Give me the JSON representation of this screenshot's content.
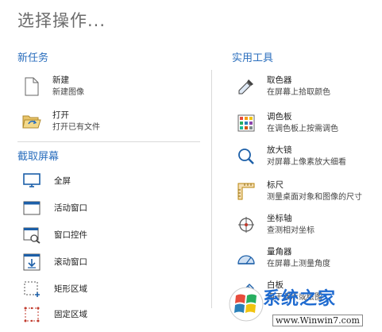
{
  "title": "选择操作...",
  "new_task": {
    "heading": "新任务",
    "items": [
      {
        "name": "新建",
        "desc": "新建图像",
        "icon": "new-document-icon"
      },
      {
        "name": "打开",
        "desc": "打开已有文件",
        "icon": "open-folder-icon"
      }
    ]
  },
  "capture": {
    "heading": "截取屏幕",
    "items": [
      {
        "name": "全屏",
        "icon": "monitor-icon"
      },
      {
        "name": "活动窗口",
        "icon": "active-window-icon"
      },
      {
        "name": "窗口控件",
        "icon": "window-control-icon"
      },
      {
        "name": "滚动窗口",
        "icon": "scrolling-window-icon"
      },
      {
        "name": "矩形区域",
        "icon": "rectangle-region-icon"
      },
      {
        "name": "固定区域",
        "icon": "fixed-region-icon"
      }
    ]
  },
  "tools": {
    "heading": "实用工具",
    "items": [
      {
        "name": "取色器",
        "desc": "在屏幕上拾取颜色",
        "icon": "eyedropper-icon"
      },
      {
        "name": "调色板",
        "desc": "在调色板上按需调色",
        "icon": "palette-icon"
      },
      {
        "name": "放大镜",
        "desc": "对屏幕上像素放大细看",
        "icon": "magnifier-icon"
      },
      {
        "name": "标尺",
        "desc": "测量桌面对象和图像的尺寸",
        "icon": "ruler-icon"
      },
      {
        "name": "坐标轴",
        "desc": "查测相对坐标",
        "icon": "crosshair-icon"
      },
      {
        "name": "量角器",
        "desc": "在屏幕上测量角度",
        "icon": "protractor-icon"
      },
      {
        "name": "白板",
        "desc": "用于演示或绘图",
        "icon": "whiteboard-pen-icon"
      }
    ]
  },
  "watermark": {
    "brand": "系统之家",
    "url": "www.Winwin7.com"
  },
  "colors": {
    "accent": "#2a6ebd",
    "title": "#6b6b6b"
  }
}
